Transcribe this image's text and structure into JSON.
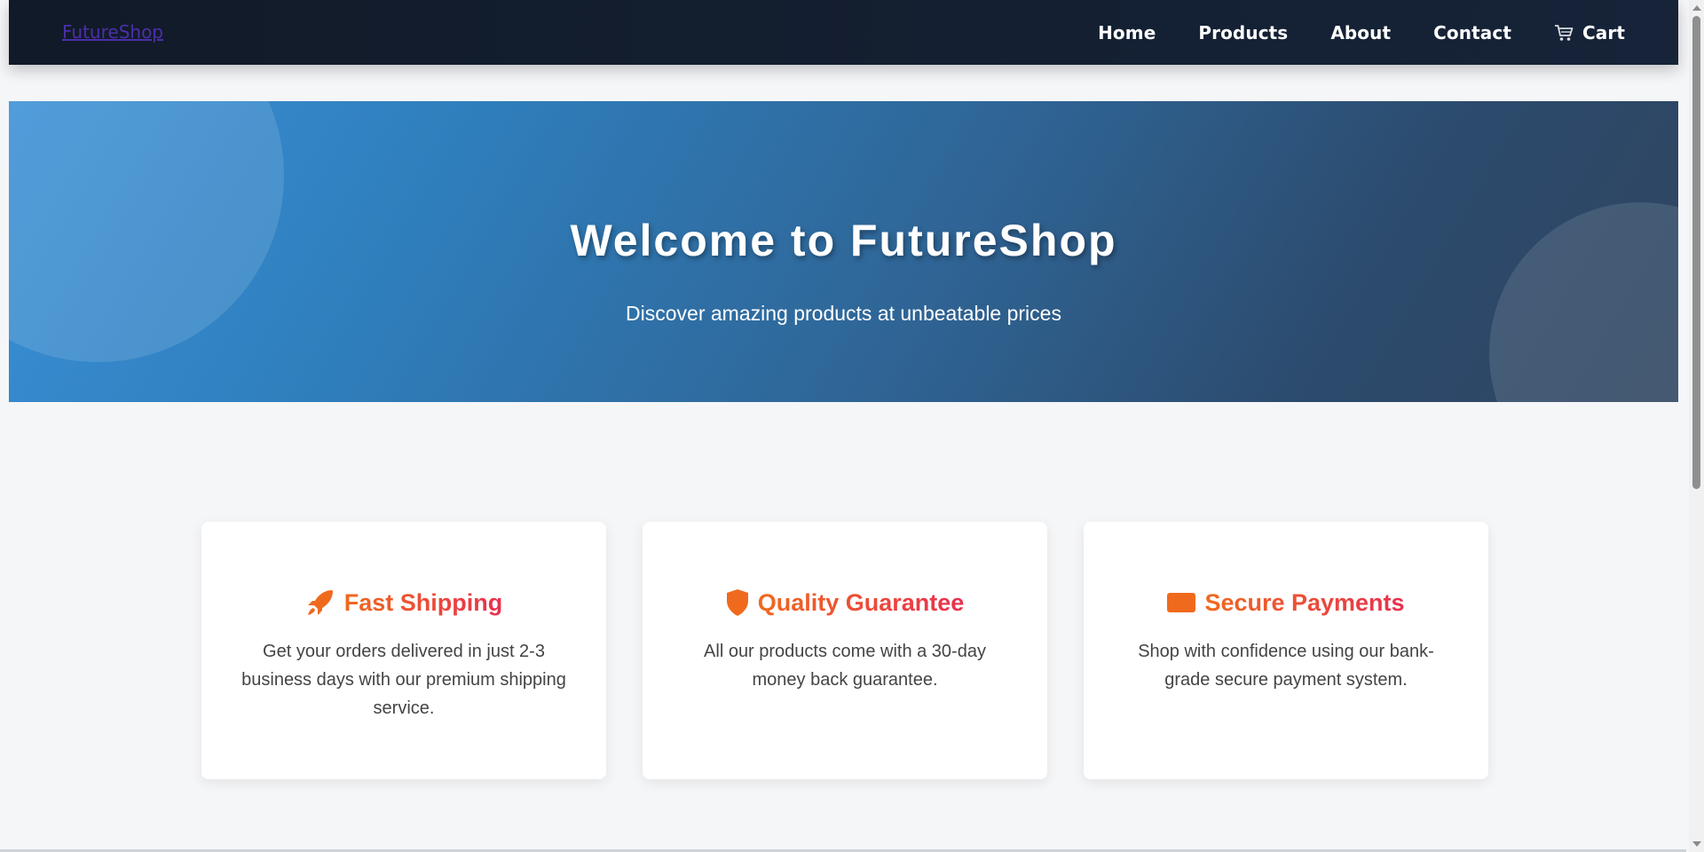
{
  "navbar": {
    "brand": "FutureShop",
    "links": [
      {
        "label": "Home"
      },
      {
        "label": "Products"
      },
      {
        "label": "About"
      },
      {
        "label": "Contact"
      },
      {
        "label": "Cart",
        "icon": "cart-icon"
      }
    ]
  },
  "hero": {
    "title": "Welcome to FutureShop",
    "subtitle": "Discover amazing products at unbeatable prices"
  },
  "features": [
    {
      "icon": "rocket-icon",
      "title": "Fast Shipping",
      "description": "Get your orders delivered in just 2-3 business days with our premium shipping service."
    },
    {
      "icon": "shield-icon",
      "title": "Quality Guarantee",
      "description": "All our products come with a 30-day money back guarantee."
    },
    {
      "icon": "credit-card-icon",
      "title": "Secure Payments",
      "description": "Shop with confidence using our bank-grade secure payment system."
    }
  ],
  "colors": {
    "nav_bg": "#111a28",
    "brand_link": "#4b2fa8",
    "hero_start": "#3a8fd6",
    "hero_end": "#2f4560",
    "accent_orange": "#f06a1e",
    "accent_red": "#e8304f"
  }
}
